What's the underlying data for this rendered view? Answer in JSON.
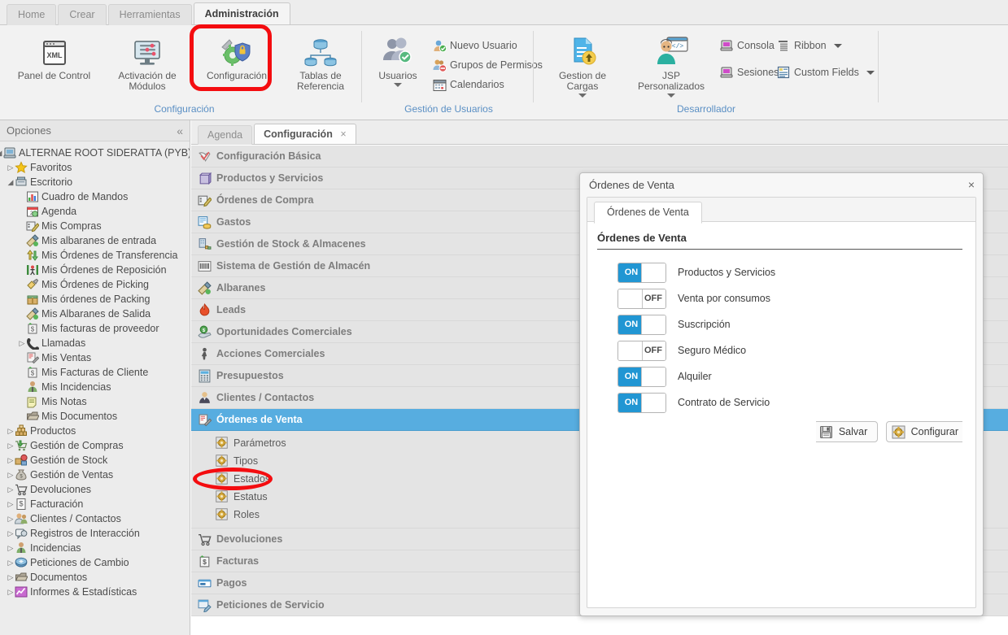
{
  "ribbon": {
    "tabs": [
      {
        "label": "Home",
        "active": false
      },
      {
        "label": "Crear",
        "active": false
      },
      {
        "label": "Herramientas",
        "active": false
      },
      {
        "label": "Administración",
        "active": true
      }
    ],
    "groups": [
      {
        "title": "Configuración",
        "big_buttons": [
          {
            "label": "Panel de Control",
            "icon": "xml-window-icon"
          },
          {
            "label": "Activación de Módulos",
            "icon": "monitor-sliders-icon"
          },
          {
            "label": "Configuración",
            "icon": "gear-shield-icon"
          },
          {
            "label": "Tablas de Referencia",
            "icon": "database-tree-icon"
          }
        ]
      },
      {
        "title": "Gestión de Usuarios",
        "big_buttons": [
          {
            "label": "Usuarios",
            "icon": "users-check-icon",
            "caret": true
          }
        ],
        "small_buttons": [
          {
            "label": "Nuevo Usuario",
            "icon": "user-add-icon"
          },
          {
            "label": "Grupos de Permisos",
            "icon": "user-group-deny-icon"
          },
          {
            "label": "Calendarios",
            "icon": "calendar-icon"
          }
        ]
      },
      {
        "title": "Desarrollador",
        "big_buttons": [
          {
            "label": "Gestion de Cargas",
            "icon": "file-upload-icon",
            "caret": true
          },
          {
            "label": "JSP Personalizados",
            "icon": "developer-code-icon",
            "caret": true
          }
        ],
        "small_buttons": [
          {
            "label": "Consola",
            "icon": "console-icon"
          },
          {
            "label": "Sesiones",
            "icon": "sessions-icon"
          },
          {
            "label": "Ribbon",
            "icon": "ribbon-list-icon",
            "caret": true
          },
          {
            "label": "Custom Fields",
            "icon": "custom-fields-icon",
            "caret": true
          }
        ]
      }
    ]
  },
  "sidebar": {
    "title": "Opciones",
    "collapse_glyph": "«",
    "tree": [
      {
        "label": "ALTERNAE ROOT SIDERATTA (PYB)",
        "depth": 0,
        "expander": "down",
        "icon": "computer-icon"
      },
      {
        "label": "Favoritos",
        "depth": 1,
        "expander": "right",
        "icon": "star-icon"
      },
      {
        "label": "Escritorio",
        "depth": 1,
        "expander": "down",
        "icon": "desktop-icon"
      },
      {
        "label": "Cuadro de Mandos",
        "depth": 2,
        "expander": "none",
        "icon": "dashboard-icon"
      },
      {
        "label": "Agenda",
        "depth": 2,
        "expander": "none",
        "icon": "agenda-icon"
      },
      {
        "label": "Mis Compras",
        "depth": 2,
        "expander": "none",
        "icon": "purchases-icon"
      },
      {
        "label": "Mis albaranes de entrada",
        "depth": 2,
        "expander": "none",
        "icon": "inbound-note-icon"
      },
      {
        "label": "Mis Órdenes de Transferencia",
        "depth": 2,
        "expander": "none",
        "icon": "transfer-icon"
      },
      {
        "label": "Mis Órdenes de Reposición",
        "depth": 2,
        "expander": "none",
        "icon": "replenish-icon"
      },
      {
        "label": "Mis Órdenes de Picking",
        "depth": 2,
        "expander": "none",
        "icon": "picking-icon"
      },
      {
        "label": "Mis órdenes de Packing",
        "depth": 2,
        "expander": "none",
        "icon": "packing-icon"
      },
      {
        "label": "Mis Albaranes de Salida",
        "depth": 2,
        "expander": "none",
        "icon": "outbound-note-icon"
      },
      {
        "label": "Mis facturas de proveedor",
        "depth": 2,
        "expander": "none",
        "icon": "supplier-invoice-icon"
      },
      {
        "label": "Llamadas",
        "depth": 2,
        "expander": "right",
        "icon": "phone-icon"
      },
      {
        "label": "Mis Ventas",
        "depth": 2,
        "expander": "none",
        "icon": "sales-icon"
      },
      {
        "label": "Mis Facturas de Cliente",
        "depth": 2,
        "expander": "none",
        "icon": "customer-invoice-icon"
      },
      {
        "label": "Mis Incidencias",
        "depth": 2,
        "expander": "none",
        "icon": "incident-icon"
      },
      {
        "label": "Mis Notas",
        "depth": 2,
        "expander": "none",
        "icon": "notes-icon"
      },
      {
        "label": "Mis Documentos",
        "depth": 2,
        "expander": "none",
        "icon": "documents-icon"
      },
      {
        "label": "Productos",
        "depth": 1,
        "expander": "right",
        "icon": "products-icon"
      },
      {
        "label": "Gestión de Compras",
        "depth": 1,
        "expander": "right",
        "icon": "cart-green-icon"
      },
      {
        "label": "Gestión de Stock",
        "depth": 1,
        "expander": "right",
        "icon": "stock-icon"
      },
      {
        "label": "Gestión de Ventas",
        "depth": 1,
        "expander": "right",
        "icon": "moneybag-icon"
      },
      {
        "label": "Devoluciones",
        "depth": 1,
        "expander": "right",
        "icon": "returns-cart-icon"
      },
      {
        "label": "Facturación",
        "depth": 1,
        "expander": "right",
        "icon": "billing-icon"
      },
      {
        "label": "Clientes / Contactos",
        "depth": 1,
        "expander": "right",
        "icon": "contacts-icon"
      },
      {
        "label": "Registros de Interacción",
        "depth": 1,
        "expander": "right",
        "icon": "interaction-log-icon"
      },
      {
        "label": "Incidencias",
        "depth": 1,
        "expander": "right",
        "icon": "incidents-icon"
      },
      {
        "label": "Peticiones de Cambio",
        "depth": 1,
        "expander": "right",
        "icon": "change-request-icon"
      },
      {
        "label": "Documentos",
        "depth": 1,
        "expander": "right",
        "icon": "documents-icon"
      },
      {
        "label": "Informes & Estadísticas",
        "depth": 1,
        "expander": "right",
        "icon": "reports-chart-icon"
      }
    ]
  },
  "main": {
    "tabs": [
      {
        "label": "Agenda",
        "active": false,
        "closable": false
      },
      {
        "label": "Configuración",
        "active": true,
        "closable": true,
        "close_glyph": "×"
      }
    ],
    "rows": [
      {
        "label": "Configuración Básica",
        "icon": "check-config-icon",
        "selected": false
      },
      {
        "label": "Productos y Servicios",
        "icon": "box-icon",
        "selected": false
      },
      {
        "label": "Órdenes de Compra",
        "icon": "purchase-order-icon",
        "selected": false
      },
      {
        "label": "Gastos",
        "icon": "expenses-icon",
        "selected": false
      },
      {
        "label": "Gestión de Stock & Almacenes",
        "icon": "warehouse-icon",
        "selected": false
      },
      {
        "label": "Sistema de Gestión de Almacén",
        "icon": "barcode-icon",
        "selected": false
      },
      {
        "label": "Albaranes",
        "icon": "delivery-note-icon",
        "selected": false
      },
      {
        "label": "Leads",
        "icon": "flame-icon",
        "selected": false
      },
      {
        "label": "Oportunidades Comerciales",
        "icon": "opportunity-icon",
        "selected": false
      },
      {
        "label": "Acciones Comerciales",
        "icon": "person-action-icon",
        "selected": false
      },
      {
        "label": "Presupuestos",
        "icon": "calculator-icon",
        "selected": false
      },
      {
        "label": "Clientes / Contactos",
        "icon": "client-icon",
        "selected": false
      },
      {
        "label": "Órdenes de Venta",
        "icon": "sales-order-icon",
        "selected": true,
        "children": [
          {
            "label": "Parámetros",
            "icon": "gear-small-icon"
          },
          {
            "label": "Tipos",
            "icon": "gear-small-icon"
          },
          {
            "label": "Estados",
            "icon": "gear-small-icon"
          },
          {
            "label": "Estatus",
            "icon": "gear-small-icon"
          },
          {
            "label": "Roles",
            "icon": "gear-small-icon"
          }
        ]
      },
      {
        "label": "Devoluciones",
        "icon": "returns-cart-icon",
        "selected": false
      },
      {
        "label": "Facturas",
        "icon": "invoice-icon",
        "selected": false
      },
      {
        "label": "Pagos",
        "icon": "payments-icon",
        "selected": false
      },
      {
        "label": "Peticiones de Servicio",
        "icon": "service-request-icon",
        "selected": false
      }
    ]
  },
  "dialog": {
    "title": "Órdenes de Venta",
    "close_glyph": "×",
    "tab_label": "Órdenes de Venta",
    "section_title": "Órdenes de Venta",
    "toggles": [
      {
        "label": "Productos y Servicios",
        "state": "ON"
      },
      {
        "label": "Venta por consumos",
        "state": "OFF"
      },
      {
        "label": "Suscripción",
        "state": "ON"
      },
      {
        "label": "Seguro Médico",
        "state": "OFF"
      },
      {
        "label": "Alquiler",
        "state": "ON"
      },
      {
        "label": "Contrato de Servicio",
        "state": "ON"
      }
    ],
    "buttons": [
      {
        "label": "Salvar",
        "icon": "save-disk-icon"
      },
      {
        "label": "Configurar",
        "icon": "gear-small-icon"
      }
    ]
  },
  "colors": {
    "accent_blue": "#2196d3",
    "selection_blue": "#57ade0",
    "group_title_blue": "#5a8fc4",
    "annotation_red": "#f40d10"
  }
}
